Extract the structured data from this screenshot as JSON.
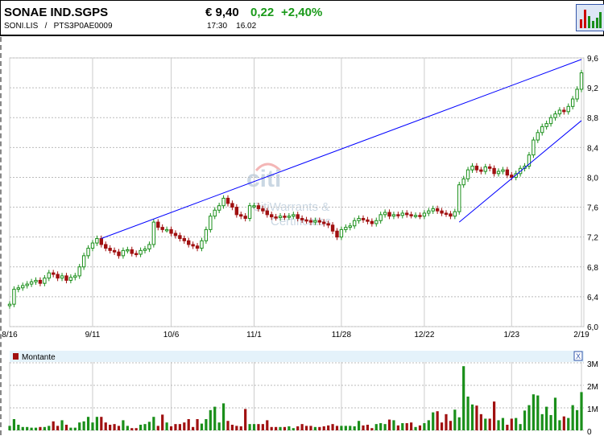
{
  "header": {
    "name": "SONAE IND.SGPS",
    "symbol_line": "SONI.LIS   /   PTS3P0AE0009",
    "price": "€ 9,40",
    "change": "0,22",
    "change_pct": "+2,40%",
    "time": "17:30    16.02",
    "chart_type_icon": "bar-chart-icon"
  },
  "watermark": {
    "logo": "citi",
    "text1": "CitiWarrants &",
    "text2": "Certificates"
  },
  "volume_panel": {
    "legend": "Montante",
    "close_label": "X"
  },
  "colors": {
    "up": "#1a8f1a",
    "down": "#a01010",
    "trendline": "#0000ff",
    "accent_positive": "#1a9a1a"
  },
  "chart_data": [
    {
      "type": "candlestick",
      "yaxis_labels": [
        "9,6",
        "9,2",
        "8,8",
        "8,4",
        "8,0",
        "7,6",
        "7,2",
        "6,8",
        "6,4",
        "6,0"
      ],
      "ylim": [
        6.0,
        9.6
      ],
      "y_ticks": [
        9.6,
        9.2,
        8.8,
        8.4,
        8.0,
        7.6,
        7.2,
        6.8,
        6.4,
        6.0
      ],
      "x_ticks": [
        {
          "label": "8/16",
          "index": 0
        },
        {
          "label": "9/11",
          "index": 19
        },
        {
          "label": "10/6",
          "index": 37
        },
        {
          "label": "11/1",
          "index": 56
        },
        {
          "label": "11/28",
          "index": 76
        },
        {
          "label": "12/22",
          "index": 95
        },
        {
          "label": "1/23",
          "index": 115
        },
        {
          "label": "2/19",
          "index": 131
        }
      ],
      "grid": true,
      "closes": [
        6.3,
        6.5,
        6.52,
        6.55,
        6.57,
        6.6,
        6.62,
        6.58,
        6.65,
        6.72,
        6.7,
        6.65,
        6.68,
        6.62,
        6.66,
        6.68,
        6.8,
        6.95,
        7.05,
        7.12,
        7.18,
        7.1,
        7.05,
        7.02,
        7.0,
        6.95,
        7.02,
        7.03,
        6.98,
        6.97,
        7.02,
        7.04,
        7.1,
        7.4,
        7.33,
        7.3,
        7.3,
        7.25,
        7.22,
        7.18,
        7.15,
        7.1,
        7.08,
        7.05,
        7.15,
        7.3,
        7.48,
        7.56,
        7.62,
        7.72,
        7.65,
        7.6,
        7.5,
        7.48,
        7.45,
        7.62,
        7.62,
        7.58,
        7.55,
        7.5,
        7.47,
        7.46,
        7.48,
        7.47,
        7.48,
        7.5,
        7.45,
        7.43,
        7.42,
        7.4,
        7.42,
        7.4,
        7.38,
        7.36,
        7.28,
        7.2,
        7.3,
        7.33,
        7.35,
        7.42,
        7.45,
        7.43,
        7.41,
        7.38,
        7.42,
        7.5,
        7.53,
        7.48,
        7.5,
        7.49,
        7.52,
        7.5,
        7.49,
        7.49,
        7.48,
        7.52,
        7.55,
        7.58,
        7.55,
        7.52,
        7.51,
        7.48,
        7.54,
        7.9,
        7.98,
        8.1,
        8.15,
        8.1,
        8.08,
        8.14,
        8.12,
        8.05,
        8.08,
        8.1,
        8.03,
        8.0,
        8.05,
        8.12,
        8.15,
        8.3,
        8.5,
        8.6,
        8.68,
        8.72,
        8.8,
        8.85,
        8.9,
        8.88,
        8.95,
        9.05,
        9.18,
        9.4
      ],
      "trendlines": [
        {
          "from": {
            "index": 21,
            "value": 7.18
          },
          "to": {
            "index": 131,
            "value": 9.58
          }
        },
        {
          "from": {
            "index": 103,
            "value": 7.4
          },
          "to": {
            "index": 131,
            "value": 8.76
          }
        }
      ]
    },
    {
      "type": "bar",
      "name": "Montante",
      "yaxis_labels": [
        "3M",
        "2M",
        "1M",
        "0"
      ],
      "ylim": [
        0,
        3
      ],
      "unit": "M",
      "values": [
        0.2,
        0.5,
        0.25,
        0.15,
        0.15,
        0.12,
        0.12,
        0.15,
        0.15,
        0.2,
        0.4,
        0.2,
        0.45,
        0.25,
        0.12,
        0.12,
        0.35,
        0.4,
        0.6,
        0.35,
        0.6,
        0.6,
        0.35,
        0.25,
        0.28,
        0.2,
        0.45,
        0.2,
        0.1,
        0.1,
        0.25,
        0.28,
        0.38,
        0.6,
        0.2,
        0.7,
        0.35,
        0.18,
        0.28,
        0.28,
        0.35,
        0.5,
        0.15,
        0.5,
        0.3,
        0.5,
        0.9,
        1.05,
        0.35,
        1.2,
        0.42,
        0.25,
        0.2,
        0.18,
        0.95,
        0.28,
        0.28,
        0.28,
        0.28,
        0.45,
        0.15,
        0.15,
        0.15,
        0.15,
        0.18,
        0.1,
        0.18,
        0.28,
        0.2,
        0.2,
        0.15,
        0.15,
        0.18,
        0.22,
        0.28,
        0.2,
        0.2,
        0.2,
        0.2,
        0.18,
        0.42,
        0.22,
        0.25,
        0.1,
        0.28,
        0.32,
        0.28,
        0.48,
        0.45,
        0.22,
        0.32,
        0.32,
        0.35,
        0.15,
        0.22,
        0.32,
        0.45,
        0.8,
        0.85,
        0.35,
        0.72,
        0.42,
        0.92,
        0.58,
        2.85,
        1.5,
        1.15,
        1.1,
        0.72,
        0.52,
        0.52,
        1.28,
        0.45,
        0.55,
        0.25,
        0.52,
        0.55,
        0.28,
        0.88,
        1.12,
        1.6,
        1.55,
        0.72,
        1.05,
        0.68,
        1.45,
        0.45,
        0.62,
        0.55,
        1.12,
        0.9,
        1.7
      ]
    }
  ]
}
